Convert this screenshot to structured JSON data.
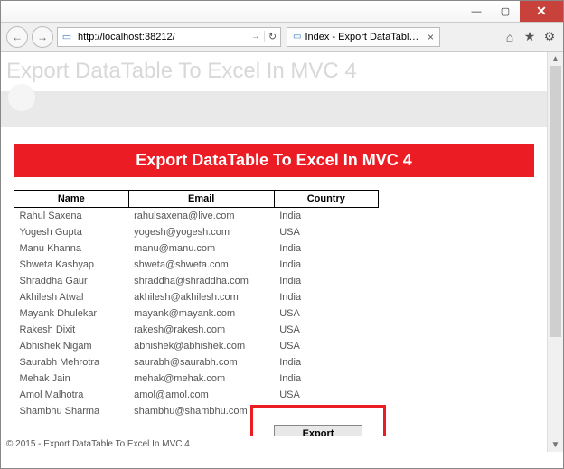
{
  "window": {
    "tab_title": "Index - Export DataTable To...",
    "url": "http://localhost:38212/"
  },
  "page": {
    "hero": "Export DataTable To Excel In MVC 4",
    "banner": "Export DataTable To Excel In MVC 4",
    "footer": "© 2015 - Export DataTable To Excel In MVC 4"
  },
  "table": {
    "headers": {
      "name": "Name",
      "email": "Email",
      "country": "Country"
    },
    "rows": [
      {
        "name": "Rahul Saxena",
        "email": "rahulsaxena@live.com",
        "country": "India"
      },
      {
        "name": "Yogesh Gupta",
        "email": "yogesh@yogesh.com",
        "country": "USA"
      },
      {
        "name": "Manu Khanna",
        "email": "manu@manu.com",
        "country": "India"
      },
      {
        "name": "Shweta Kashyap",
        "email": "shweta@shweta.com",
        "country": "India"
      },
      {
        "name": "Shraddha Gaur",
        "email": "shraddha@shraddha.com",
        "country": "India"
      },
      {
        "name": "Akhilesh Atwal",
        "email": "akhilesh@akhilesh.com",
        "country": "India"
      },
      {
        "name": "Mayank Dhulekar",
        "email": "mayank@mayank.com",
        "country": "USA"
      },
      {
        "name": "Rakesh Dixit",
        "email": "rakesh@rakesh.com",
        "country": "USA"
      },
      {
        "name": "Abhishek Nigam",
        "email": "abhishek@abhishek.com",
        "country": "USA"
      },
      {
        "name": "Saurabh Mehrotra",
        "email": "saurabh@saurabh.com",
        "country": "India"
      },
      {
        "name": "Mehak Jain",
        "email": "mehak@mehak.com",
        "country": "India"
      },
      {
        "name": "Amol Malhotra",
        "email": "amol@amol.com",
        "country": "USA"
      },
      {
        "name": "Shambhu Sharma",
        "email": "shambhu@shambhu.com",
        "country": ""
      }
    ]
  },
  "buttons": {
    "export": "Export"
  }
}
